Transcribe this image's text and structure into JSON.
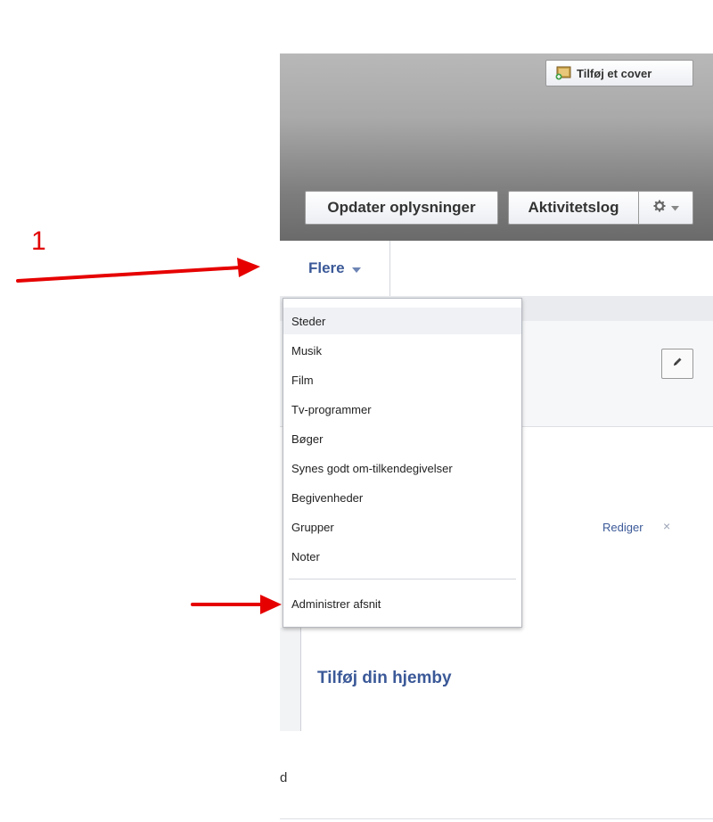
{
  "annotation": {
    "step_number": "1"
  },
  "cover": {
    "add_cover_label": "Tilføj et cover"
  },
  "header": {
    "update_info_label": "Opdater oplysninger",
    "activity_log_label": "Aktivitetslog"
  },
  "nav": {
    "more_label": "Flere"
  },
  "dropdown": {
    "items": [
      "Steder",
      "Musik",
      "Film",
      "Tv-programmer",
      "Bøger",
      "Synes godt om-tilkendegivelser",
      "Begivenheder",
      "Grupper",
      "Noter"
    ],
    "manage_label": "Administrer afsnit"
  },
  "content": {
    "edit_link": "Rediger",
    "close_symbol": "×",
    "hometown_label": "Tilføj din hjemby",
    "fragment_text": "d"
  },
  "colors": {
    "annotation_red": "#e10000",
    "link_blue": "#3b5998"
  }
}
